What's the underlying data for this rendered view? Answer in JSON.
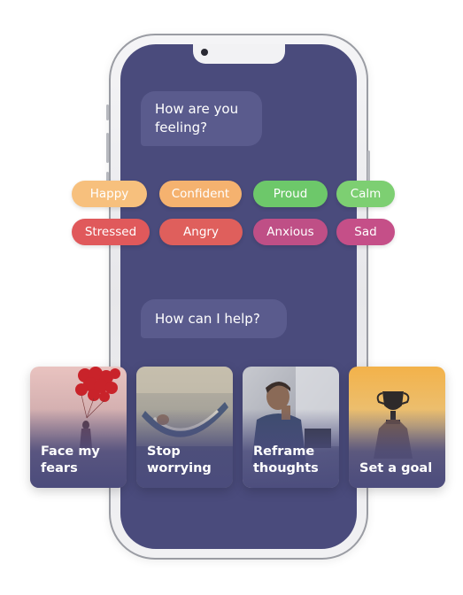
{
  "chat": {
    "question_feeling": "How are you feeling?",
    "question_help": "How can I help?"
  },
  "moods": [
    {
      "label": "Happy",
      "color": "#f7c07d"
    },
    {
      "label": "Confident",
      "color": "#f5b26f"
    },
    {
      "label": "Proud",
      "color": "#6dc86a"
    },
    {
      "label": "Calm",
      "color": "#7dcf72"
    },
    {
      "label": "Stressed",
      "color": "#e0595b"
    },
    {
      "label": "Angry",
      "color": "#df5f5c"
    },
    {
      "label": "Anxious",
      "color": "#bf4f86"
    },
    {
      "label": "Sad",
      "color": "#c54f88"
    }
  ],
  "actions": [
    {
      "label": "Face my fears",
      "icon": "red-balloons-image"
    },
    {
      "label": "Stop worrying",
      "icon": "hammock-image"
    },
    {
      "label": "Reframe thoughts",
      "icon": "thinking-man-image"
    },
    {
      "label": "Set a goal",
      "icon": "trophy-image"
    }
  ],
  "colors": {
    "screen_background": "#4a4b7c",
    "bubble_background": "#5a5b8d"
  }
}
